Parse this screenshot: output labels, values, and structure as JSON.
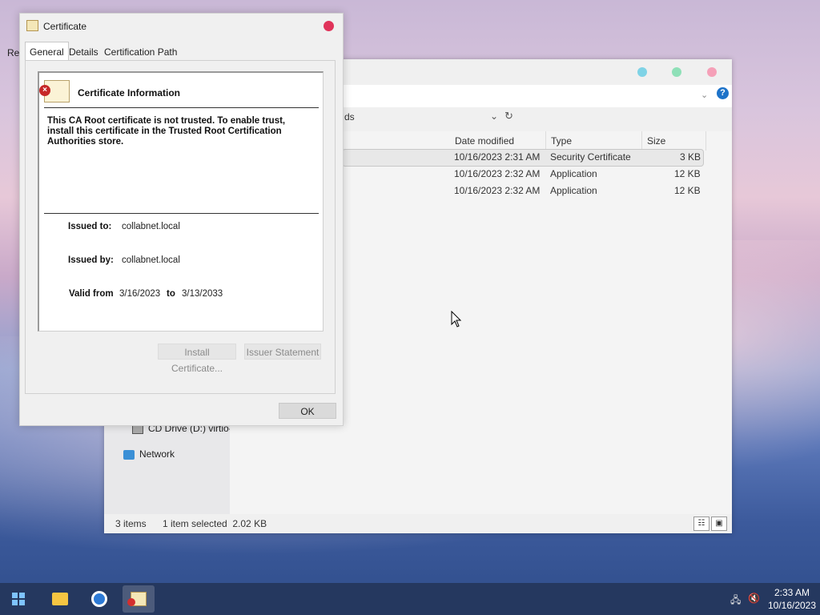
{
  "desktop": {
    "partial_label": "Re"
  },
  "explorer": {
    "address_tail": "ds",
    "columns": [
      "Date modified",
      "Type",
      "Size"
    ],
    "rows": [
      {
        "date": "10/16/2023 2:31 AM",
        "type": "Security Certificate",
        "size": "3 KB",
        "selected": true
      },
      {
        "date": "10/16/2023 2:32 AM",
        "type": "Application",
        "size": "12 KB",
        "selected": false
      },
      {
        "date": "10/16/2023 2:32 AM",
        "type": "Application",
        "size": "12 KB",
        "selected": false
      }
    ],
    "nav": {
      "cd_drive": "CD Drive (D:) virtio-",
      "network": "Network"
    },
    "status": {
      "items": "3 items",
      "selected": "1 item selected  2.02 KB"
    }
  },
  "certificate": {
    "title": "Certificate",
    "tabs": [
      "General",
      "Details",
      "Certification Path"
    ],
    "active_tab": "General",
    "heading": "Certificate Information",
    "warning": "This CA Root certificate is not trusted. To enable trust, install this certificate in the Trusted Root Certification Authorities store.",
    "issued_to_label": "Issued to:",
    "issued_to": "collabnet.local",
    "issued_by_label": "Issued by:",
    "issued_by": "collabnet.local",
    "valid_from_label": "Valid from",
    "valid_from": "3/16/2023",
    "to_label": "to",
    "valid_to": "3/13/2033",
    "install_button": "Install Certificate...",
    "issuer_button": "Issuer Statement",
    "ok_button": "OK"
  },
  "taskbar": {
    "time": "2:33 AM",
    "date": "10/16/2023",
    "apps": [
      "file-explorer-icon",
      "chrome-icon",
      "certificate-icon"
    ]
  },
  "colors": {
    "taskbar": "#25385f",
    "close_button": "#e0335a",
    "help_icon": "#1e73c9"
  }
}
